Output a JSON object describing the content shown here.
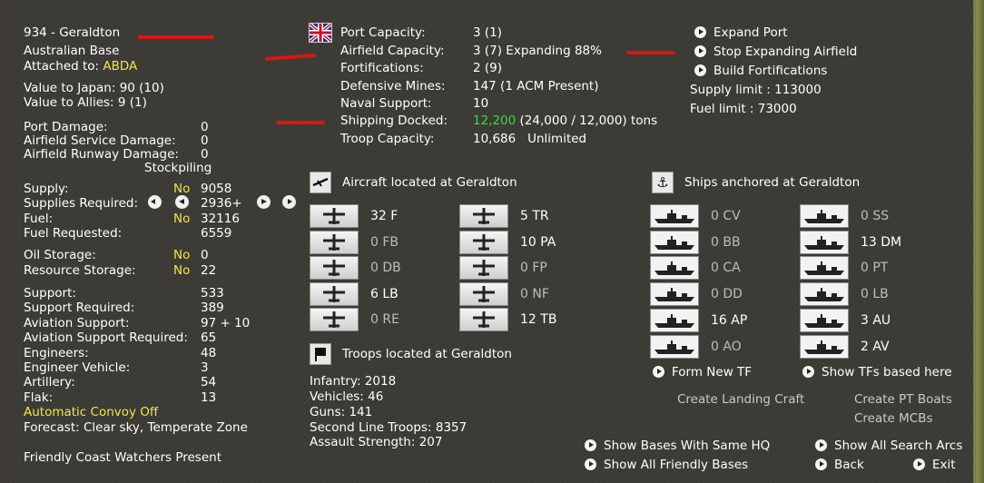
{
  "base": {
    "id_name": "934 - Geraldton",
    "type": "Australian Base",
    "attached_label": "Attached to:",
    "attached_value": "ABDA",
    "value_japan": "Value to Japan: 90 (10)",
    "value_allies": "Value to Allies: 9 (1)"
  },
  "damage": [
    {
      "label": "Port Damage:",
      "value": "0"
    },
    {
      "label": "Airfield Service Damage:",
      "value": "0"
    },
    {
      "label": "Airfield Runway Damage:",
      "value": "0"
    }
  ],
  "stockpiling": "Stockpiling",
  "supply": {
    "supply_label": "Supply:",
    "supply_flag": "No",
    "supply_value": "9058",
    "required_label": "Supplies Required:",
    "required_value": "2936+",
    "fuel_label": "Fuel:",
    "fuel_flag": "No",
    "fuel_value": "32116",
    "fuel_req_label": "Fuel Requested:",
    "fuel_req_value": "6559",
    "oil_label": "Oil Storage:",
    "oil_flag": "No",
    "oil_value": "0",
    "res_label": "Resource Storage:",
    "res_flag": "No",
    "res_value": "22"
  },
  "support": [
    {
      "label": "Support:",
      "value": "533"
    },
    {
      "label": "Support Required:",
      "value": "389"
    },
    {
      "label": "Aviation Support:",
      "value": "97 + 10"
    },
    {
      "label": "Aviation Support Required:",
      "value": "65"
    },
    {
      "label": "Engineers:",
      "value": "48"
    },
    {
      "label": "Engineer Vehicle:",
      "value": "3"
    },
    {
      "label": "Artillery:",
      "value": "54"
    },
    {
      "label": "Flak:",
      "value": "13"
    }
  ],
  "convoy": "Automatic Convoy Off",
  "forecast": "Forecast: Clear sky, Temperate Zone",
  "coast_watchers": "Friendly Coast Watchers Present",
  "capacity": [
    {
      "label": "Port Capacity:",
      "value": "3 (1)"
    },
    {
      "label": "Airfield Capacity:",
      "value": "3 (7) Expanding 88%"
    },
    {
      "label": "Fortifications:",
      "value": "2 (9)"
    },
    {
      "label": "Defensive Mines:",
      "value": "147 (1 ACM Present)"
    },
    {
      "label": "Naval Support:",
      "value": "10"
    }
  ],
  "shipping": {
    "label": "Shipping Docked:",
    "green": "12,200",
    "rest": " (24,000 / 12,000) tons"
  },
  "troop_capacity": {
    "label": "Troop Capacity:",
    "value": "10,686   Unlimited"
  },
  "actions": {
    "expand_port": "Expand Port",
    "stop_expanding": "Stop Expanding Airfield",
    "build_fort": "Build Fortifications",
    "supply_limit": "Supply limit : 113000",
    "fuel_limit": "Fuel limit : 73000"
  },
  "aircraft_title": "Aircraft located at Geraldton",
  "aircraft": [
    {
      "count": "32",
      "type": "F",
      "dim": false
    },
    {
      "count": "5",
      "type": "TR",
      "dim": false
    },
    {
      "count": "0",
      "type": "FB",
      "dim": true
    },
    {
      "count": "10",
      "type": "PA",
      "dim": false
    },
    {
      "count": "0",
      "type": "DB",
      "dim": true
    },
    {
      "count": "0",
      "type": "FP",
      "dim": true
    },
    {
      "count": "6",
      "type": "LB",
      "dim": false
    },
    {
      "count": "0",
      "type": "NF",
      "dim": true
    },
    {
      "count": "0",
      "type": "RE",
      "dim": true
    },
    {
      "count": "12",
      "type": "TB",
      "dim": false
    }
  ],
  "ships_title": "Ships anchored at Geraldton",
  "ships": [
    {
      "count": "0",
      "type": "CV",
      "dim": true
    },
    {
      "count": "0",
      "type": "SS",
      "dim": true
    },
    {
      "count": "0",
      "type": "BB",
      "dim": true
    },
    {
      "count": "13",
      "type": "DM",
      "dim": false
    },
    {
      "count": "0",
      "type": "CA",
      "dim": true
    },
    {
      "count": "0",
      "type": "PT",
      "dim": true
    },
    {
      "count": "0",
      "type": "DD",
      "dim": true
    },
    {
      "count": "0",
      "type": "LB",
      "dim": true
    },
    {
      "count": "16",
      "type": "AP",
      "dim": false
    },
    {
      "count": "3",
      "type": "AU",
      "dim": false
    },
    {
      "count": "0",
      "type": "AO",
      "dim": true
    },
    {
      "count": "2",
      "type": "AV",
      "dim": false
    }
  ],
  "troops_title": "Troops located at Geraldton",
  "troops": [
    "Infantry: 2018",
    "Vehicles: 46",
    "Guns: 141",
    "Second Line Troops: 8357",
    "Assault Strength: 207"
  ],
  "tf": {
    "form_new": "Form New TF",
    "show_tfs": "Show TFs based here",
    "landing": "Create Landing Craft",
    "pt_boats": "Create PT Boats",
    "mcbs": "Create MCBs"
  },
  "bottom": {
    "same_hq": "Show Bases With Same HQ",
    "all_search": "Show All Search Arcs",
    "all_friendly": "Show All Friendly Bases",
    "back": "Back",
    "exit": "Exit"
  },
  "colors": {
    "accent_yellow": "#f0e64a",
    "green": "#3fd83f",
    "markup_red": "#e01414"
  }
}
